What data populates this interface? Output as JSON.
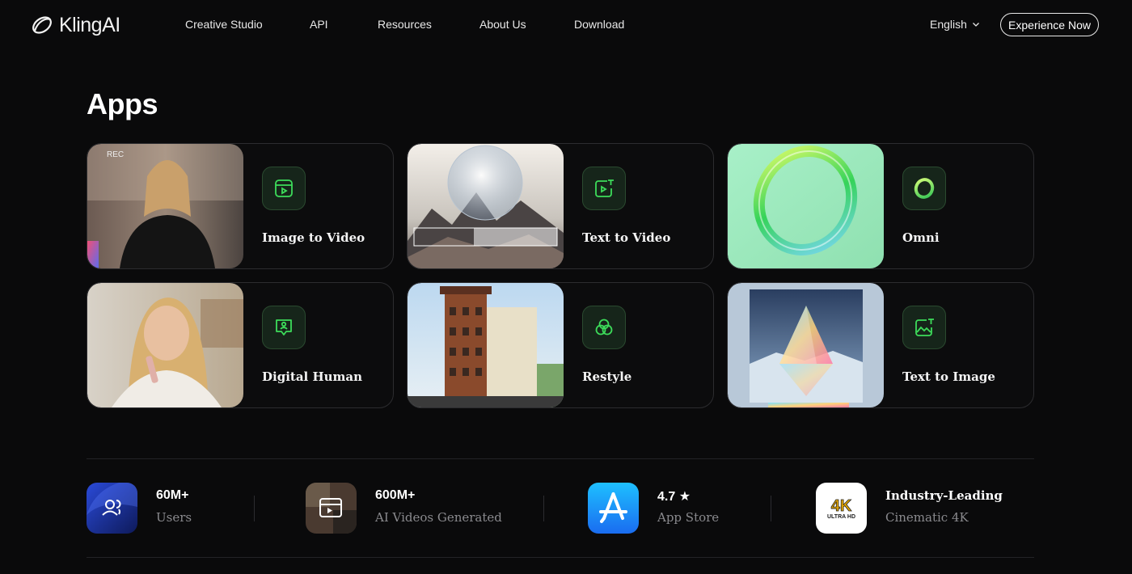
{
  "brand": {
    "name": "KlingAI"
  },
  "nav": {
    "links": [
      "Creative Studio",
      "API",
      "Resources",
      "About Us",
      "Download"
    ],
    "language": "English",
    "cta": "Experience Now"
  },
  "apps": {
    "title": "Apps",
    "items": [
      {
        "label": "Image to Video",
        "icon": "image-to-video-icon",
        "thumb_text": "REC"
      },
      {
        "label": "Text to Video",
        "icon": "text-to-video-icon"
      },
      {
        "label": "Omni",
        "icon": "omni-ring-icon"
      },
      {
        "label": "Digital Human",
        "icon": "digital-human-icon"
      },
      {
        "label": "Restyle",
        "icon": "restyle-icon"
      },
      {
        "label": "Text to Image",
        "icon": "text-to-image-icon"
      }
    ]
  },
  "stats": [
    {
      "value": "60M+",
      "label": "Users",
      "icon": "users-icon"
    },
    {
      "value": "600M+",
      "label": "AI Videos Generated",
      "icon": "video-icon"
    },
    {
      "value": "4.7 ★",
      "label": "App Store",
      "icon": "app-store-icon"
    },
    {
      "value": "Industry-Leading",
      "label": "Cinematic 4K",
      "icon": "4k-ultra-hd-icon",
      "icon_text_main": "4K",
      "icon_text_sub": "ULTRA HD"
    }
  ],
  "colors": {
    "background": "#0a0a0b",
    "accent_green": "#3ddc5a",
    "card_border": "#2c2c2f",
    "muted_text": "#8a8a8e"
  }
}
